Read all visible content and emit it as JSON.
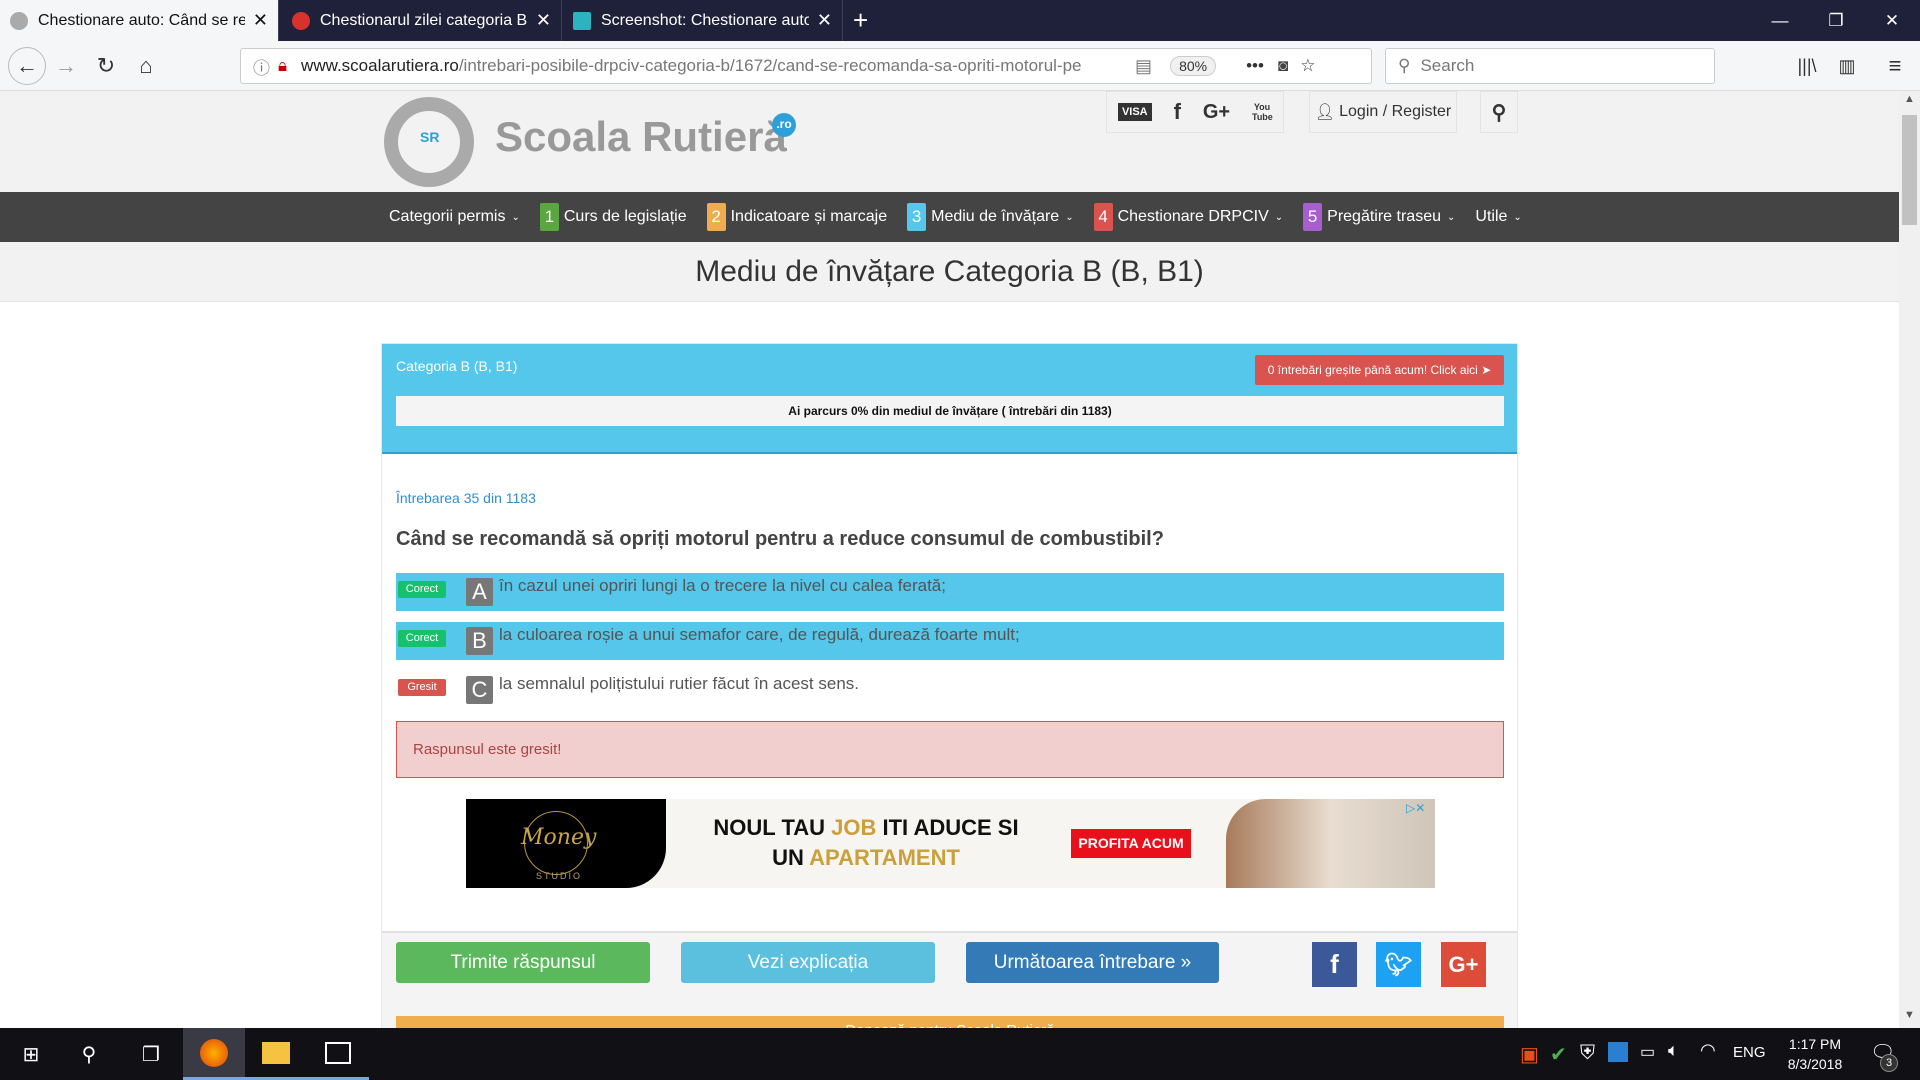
{
  "browser": {
    "tabs": [
      {
        "label": "Chestionare auto: Când se recomandă",
        "icon": "steering-wheel-icon"
      },
      {
        "label": "Chestionarul zilei categoria B - ",
        "icon": "stop-sign-icon"
      },
      {
        "label": "Screenshot: Chestionare auto: Când",
        "icon": "screenshot-tool-icon"
      }
    ],
    "url_domain": "www.scoalarutiera.ro",
    "url_path": "/intrebari-posibile-drpciv-categoria-b/1672/cand-se-recomanda-sa-opriti-motorul-pe",
    "zoom": "80%",
    "search_placeholder": "Search"
  },
  "site": {
    "logo_text": "Scoala Rutieră",
    "logo_badge": ".ro",
    "logo_initials": "SR",
    "header_icons": [
      "VISA",
      "f",
      "G+",
      "You Tube"
    ],
    "login": "Login / Register",
    "nav": [
      {
        "label": "Categorii permis",
        "caret": true
      },
      {
        "num": "1",
        "label": "Curs de legislație",
        "color": "#5aa640"
      },
      {
        "num": "2",
        "label": "Indicatoare și marcaje",
        "color": "#f0ad4e"
      },
      {
        "num": "3",
        "label": "Mediu de învățare",
        "color": "#54c7ea",
        "caret": true
      },
      {
        "num": "4",
        "label": "Chestionare DRPCIV",
        "color": "#d9534f",
        "caret": true
      },
      {
        "num": "5",
        "label": "Pregătire traseu",
        "color": "#a75fd0",
        "caret": true
      },
      {
        "label": "Utile",
        "caret": true
      }
    ],
    "page_title": "Mediu de învățare Categoria B (B, B1)"
  },
  "quiz": {
    "category": "Categoria B (B, B1)",
    "wrong_button": "0 întrebări greșite până acum! Click aici",
    "progress_text": "Ai parcurs 0% din mediul de învățare ( întrebări din 1183)",
    "progress_percent": 0,
    "counter": "Întrebarea 35 din 1183",
    "question": "Când se recomandă să opriți motorul pentru a reduce consumul de combustibil?",
    "options": [
      {
        "badge": "Corect",
        "letter": "A",
        "text": "în cazul unei opriri lungi la o trecere la nivel cu calea ferată;",
        "selected": true
      },
      {
        "badge": "Corect",
        "letter": "B",
        "text": "la culoarea roșie a unui semafor care, de regulă, durează foarte mult;",
        "selected": true
      },
      {
        "badge": "Gresit",
        "letter": "C",
        "text": "la semnalul polițistului rutier făcut în acest sens.",
        "selected": false
      }
    ],
    "result": "Raspunsul este gresit!",
    "buttons": {
      "submit": "Trimite răspunsul",
      "explain": "Vezi explicația",
      "next": "Următoarea întrebare »"
    },
    "donate": "Donează pentru Școala Rutieră"
  },
  "ad": {
    "brand": "Money",
    "brand_sub": "STUDIO",
    "line1_a": "NOUL TAU ",
    "line1_b": "JOB",
    "line1_c": " ITI ADUCE SI",
    "line2_a": "UN ",
    "line2_b": "APARTAMENT",
    "cta": "PROFITA ACUM"
  },
  "taskbar": {
    "lang": "ENG",
    "time": "1:17 PM",
    "date": "8/3/2018",
    "notifications": "3"
  }
}
